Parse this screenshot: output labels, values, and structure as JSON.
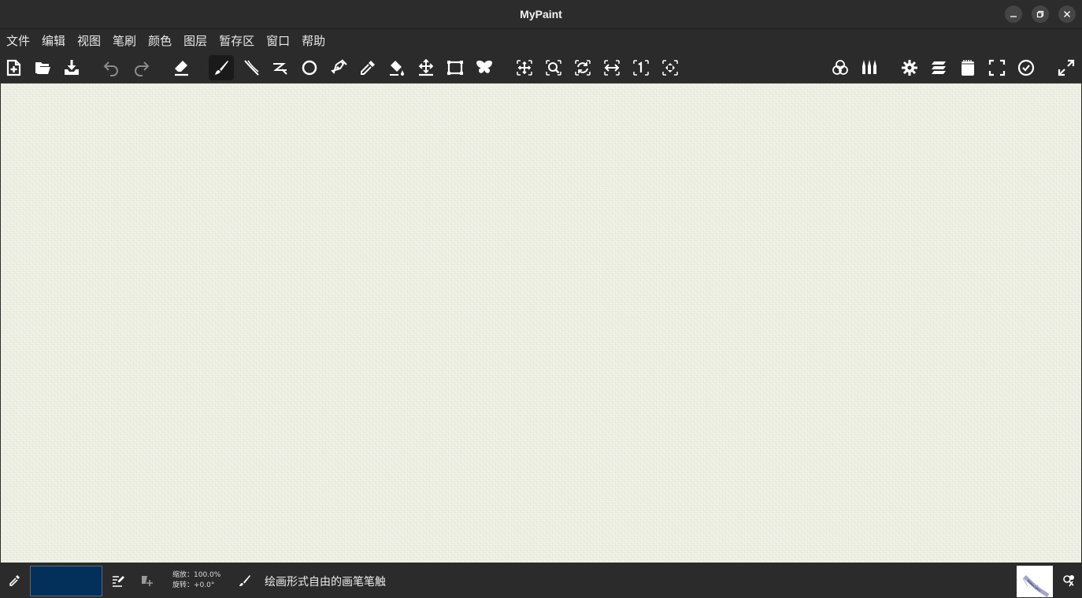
{
  "window": {
    "title": "MyPaint"
  },
  "window_controls": [
    {
      "name": "minimize-button",
      "icon": "minimize-icon"
    },
    {
      "name": "restore-button",
      "icon": "restore-icon"
    },
    {
      "name": "close-button",
      "icon": "close-icon"
    }
  ],
  "menu": {
    "file": "文件",
    "edit": "编辑",
    "view": "视图",
    "brush": "笔刷",
    "color": "颜色",
    "layer": "图层",
    "scratchpad": "暂存区",
    "window": "窗口",
    "help": "帮助"
  },
  "toolbar": {
    "icons": [
      "new-document-icon",
      "open-icon",
      "save-icon",
      "undo-icon",
      "redo-icon",
      "eraser-icon",
      "freehand-brush-icon",
      "inking-icon",
      "connected-lines-icon",
      "ellipse-icon",
      "pen-edit-icon",
      "color-picker-icon",
      "fill-icon",
      "move-layer-icon",
      "frame-icon",
      "symmetry-icon",
      "pan-view-icon",
      "zoom-view-icon",
      "rotate-view-icon",
      "mirror-view-icon",
      "reset-zoom-icon",
      "fit-view-icon",
      "color-palette-icon",
      "brushes-icon",
      "settings-icon",
      "layers-icon",
      "scratchpad-icon",
      "fullscreen-icon",
      "clock-icon",
      "expand-icon"
    ],
    "active": "freehand-brush-icon",
    "disabled": [
      "undo-icon",
      "redo-icon"
    ]
  },
  "status": {
    "current_color": "#03305a",
    "zoom_label": "缩放：100.0%",
    "rotate_label": "旋转：+0.0°",
    "brush_description": "绘画形式自由的画笔笔触"
  }
}
